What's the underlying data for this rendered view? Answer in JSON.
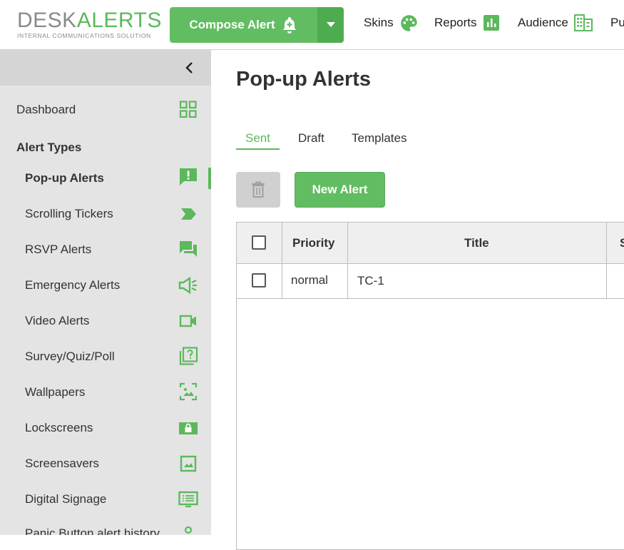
{
  "header": {
    "logo_desk": "DESK",
    "logo_alerts": "ALERTS",
    "logo_tagline": "INTERNAL COMMUNICATIONS SOLUTION",
    "compose_label": "Compose Alert",
    "nav": [
      {
        "label": "Skins",
        "icon": "palette-icon"
      },
      {
        "label": "Reports",
        "icon": "bar-chart-icon"
      },
      {
        "label": "Audience",
        "icon": "building-icon"
      },
      {
        "label": "Pu",
        "icon": ""
      }
    ]
  },
  "sidebar": {
    "dashboard_label": "Dashboard",
    "section_label": "Alert Types",
    "items": [
      {
        "label": "Pop-up Alerts",
        "icon": "alert-message-icon",
        "active": true
      },
      {
        "label": "Scrolling Tickers",
        "icon": "ticker-arrow-icon"
      },
      {
        "label": "RSVP Alerts",
        "icon": "chat-bubbles-icon"
      },
      {
        "label": "Emergency Alerts",
        "icon": "megaphone-icon"
      },
      {
        "label": "Video Alerts",
        "icon": "video-camera-icon"
      },
      {
        "label": "Survey/Quiz/Poll",
        "icon": "question-stack-icon"
      },
      {
        "label": "Wallpapers",
        "icon": "wallpaper-icon"
      },
      {
        "label": "Lockscreens",
        "icon": "lockscreen-icon"
      },
      {
        "label": "Screensavers",
        "icon": "image-icon"
      },
      {
        "label": "Digital Signage",
        "icon": "signage-icon"
      },
      {
        "label": "Panic Button alert history",
        "icon": "panic-icon"
      }
    ]
  },
  "main": {
    "title": "Pop-up Alerts",
    "tabs": [
      {
        "label": "Sent",
        "active": true
      },
      {
        "label": "Draft"
      },
      {
        "label": "Templates"
      }
    ],
    "new_alert_label": "New Alert",
    "table": {
      "columns": [
        "Priority",
        "Title",
        "S"
      ],
      "rows": [
        {
          "priority": "normal",
          "title": "TC-1"
        }
      ]
    }
  },
  "colors": {
    "accent": "#5cb85c",
    "sidebar_bg": "#e4e4e4",
    "header_bg": "#efefef"
  }
}
